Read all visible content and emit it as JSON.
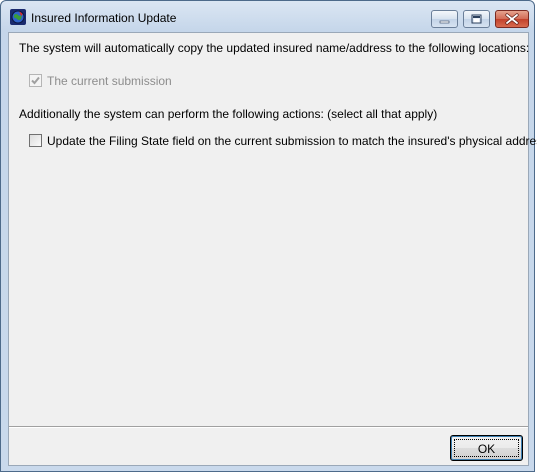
{
  "window": {
    "title": "Insured Information Update",
    "app_icon": "app-globe-icon",
    "controls": {
      "minimize_icon": "minimize-icon",
      "maximize_icon": "maximize-icon",
      "close_icon": "close-icon"
    }
  },
  "content": {
    "intro_text": "The system will automatically copy the updated insured name/address to the following locations:",
    "locations": [
      {
        "label": "The current submission",
        "checked": true,
        "enabled": false
      }
    ],
    "actions_text": "Additionally the system can perform the following actions:  (select all that apply)",
    "actions": [
      {
        "label": "Update the Filing State field on the current submission to match the insured's physical address",
        "checked": false,
        "enabled": true
      }
    ]
  },
  "footer": {
    "ok_label": "OK"
  },
  "colors": {
    "close_button": "#c2412b",
    "client_background": "#f0f0f0",
    "disabled_text": "#8d8d8d"
  }
}
